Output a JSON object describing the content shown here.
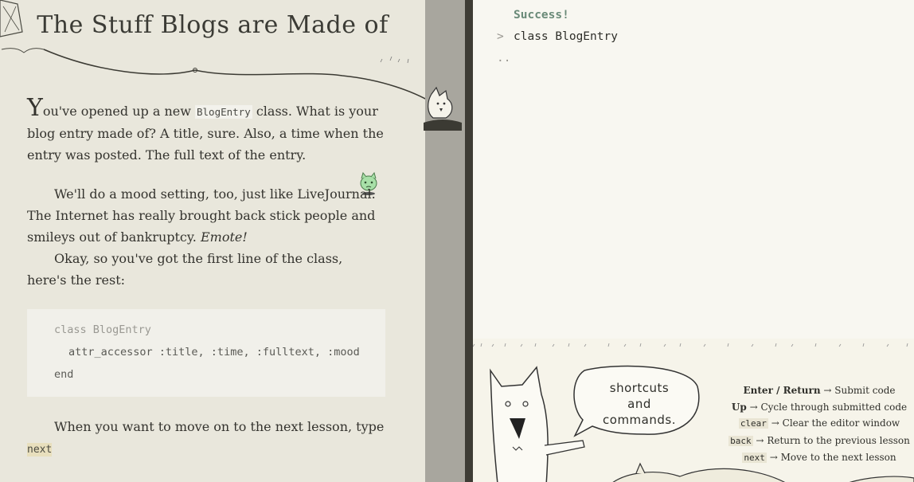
{
  "lesson": {
    "title": "The Stuff Blogs are Made of",
    "para1": {
      "dropcap": "Y",
      "before_code": "ou've opened up a new ",
      "code": "BlogEntry",
      "after_code": " class. What is your blog entry made of? A title, sure. Also, a time when the entry was posted. The full text of the entry."
    },
    "para2": {
      "text": "We'll do a mood setting, too, just like LiveJournal. The Internet has really brought back stick people and smileys out of bankruptcy. ",
      "emphasis": "Emote!"
    },
    "para3": "Okay, so you've got the first line of the class, here's the rest:",
    "code_block": {
      "line1": "class BlogEntry",
      "line2": "attr_accessor :title, :time, :fulltext, :mood",
      "line3": "end"
    },
    "para4": {
      "text": "When you want to move on to the next lesson, type",
      "command": "next"
    }
  },
  "console": {
    "success_text": "Success!",
    "prompt_marker": ">",
    "prompt_text": "class BlogEntry",
    "continue_marker": ".."
  },
  "shortcuts": {
    "bubble_line1": "shortcuts",
    "bubble_line2": "and",
    "bubble_line3": "commands.",
    "items": [
      {
        "key": "Enter / Return",
        "desc": "Submit code"
      },
      {
        "key": "Up",
        "desc": "Cycle through submitted code"
      },
      {
        "key": "clear",
        "desc": "Clear the editor window"
      },
      {
        "key": "back",
        "desc": "Return to the previous lesson"
      },
      {
        "key": "next",
        "desc": "Move to the next lesson"
      }
    ],
    "arrow": "→"
  },
  "colors": {
    "success": "#6a8a78",
    "lesson_bg": "#e9e7dc",
    "console_bg": "#f8f7f1",
    "divider": "#a8a69e"
  }
}
